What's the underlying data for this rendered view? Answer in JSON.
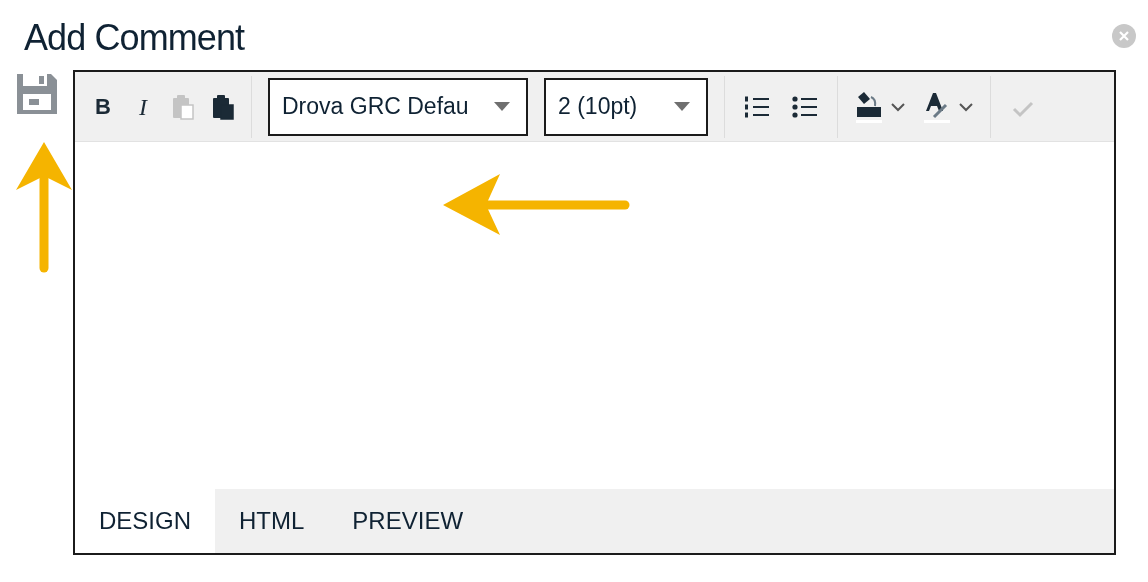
{
  "dialog": {
    "title": "Add Comment"
  },
  "toolbar": [
    {
      "kind": "bold",
      "label": "B",
      "disabled": false
    },
    {
      "kind": "italic",
      "label": "I",
      "disabled": false
    },
    {
      "kind": "paste",
      "disabled": true
    },
    {
      "kind": "paste-word",
      "disabled": false
    },
    {
      "kind": "separator"
    },
    {
      "kind": "select",
      "value": "Drova GRC Defau"
    },
    {
      "kind": "select",
      "value": "2 (10pt)"
    },
    {
      "kind": "separator"
    },
    {
      "kind": "ordered-list",
      "disabled": false
    },
    {
      "kind": "bullet-list",
      "disabled": false
    },
    {
      "kind": "separator"
    },
    {
      "kind": "highlight",
      "disabled": false
    },
    {
      "kind": "font-color",
      "disabled": false
    },
    {
      "kind": "separator"
    },
    {
      "kind": "spellcheck",
      "disabled": true
    }
  ],
  "tabs": [
    {
      "label": "DESIGN",
      "selected": true
    },
    {
      "label": "HTML",
      "selected": false
    },
    {
      "label": "PREVIEW",
      "selected": false
    }
  ]
}
